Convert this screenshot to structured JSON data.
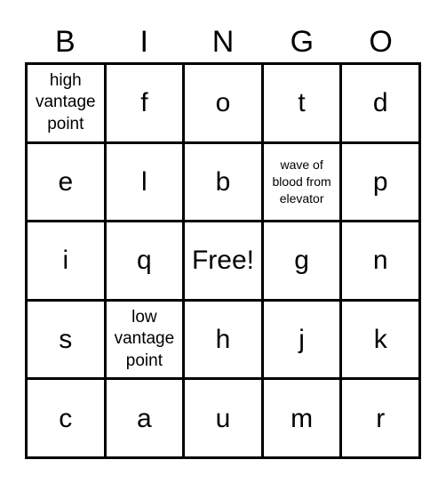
{
  "header": [
    "B",
    "I",
    "N",
    "G",
    "O"
  ],
  "cells": [
    [
      "high vantage point",
      "f",
      "o",
      "t",
      "d"
    ],
    [
      "e",
      "l",
      "b",
      "wave of blood from elevator",
      "p"
    ],
    [
      "i",
      "q",
      "Free!",
      "g",
      "n"
    ],
    [
      "s",
      "low vantage point",
      "h",
      "j",
      "k"
    ],
    [
      "c",
      "a",
      "u",
      "m",
      "r"
    ]
  ]
}
